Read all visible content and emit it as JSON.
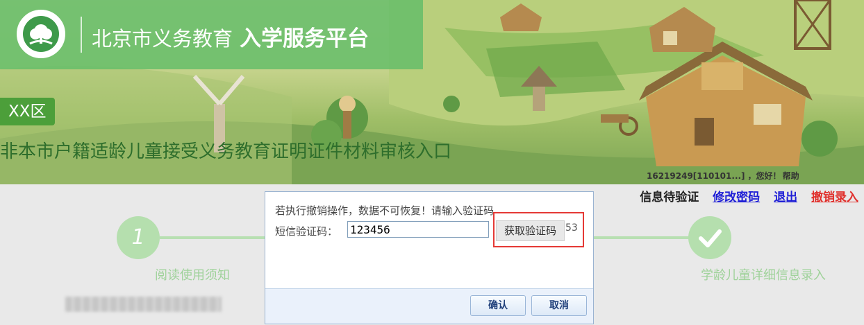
{
  "header": {
    "site_name": "北京市义务教育",
    "site_name_bold": "入学服务平台",
    "district": "XX区",
    "page_title": "非本市户籍适龄儿童接受义务教育证明证件材料审核入口"
  },
  "user_bar": {
    "account": "16219249[110101...]",
    "greeting": "，您好！",
    "help": "帮助"
  },
  "status_links": {
    "status": "信息待验证",
    "change_password": "修改密码",
    "logout": "退出",
    "revoke_entry": "撤销录入"
  },
  "steps": [
    {
      "number": "1",
      "label": "阅读使用须知"
    },
    {
      "number": "",
      "label": "学龄儿童详细信息录入"
    }
  ],
  "dialog": {
    "message": "若执行撤销操作，数据不可恢复！请输入验证码",
    "code_label": "短信验证码：",
    "code_value": "123456",
    "get_code_button": "获取验证码",
    "countdown": "53",
    "confirm": "确认",
    "cancel": "取消"
  },
  "colors": {
    "brand_green": "#68be6a",
    "badge_green": "#4c9f3a",
    "link_blue": "#1f1fd6",
    "link_red": "#e0302c",
    "highlight_red": "#e53935"
  }
}
